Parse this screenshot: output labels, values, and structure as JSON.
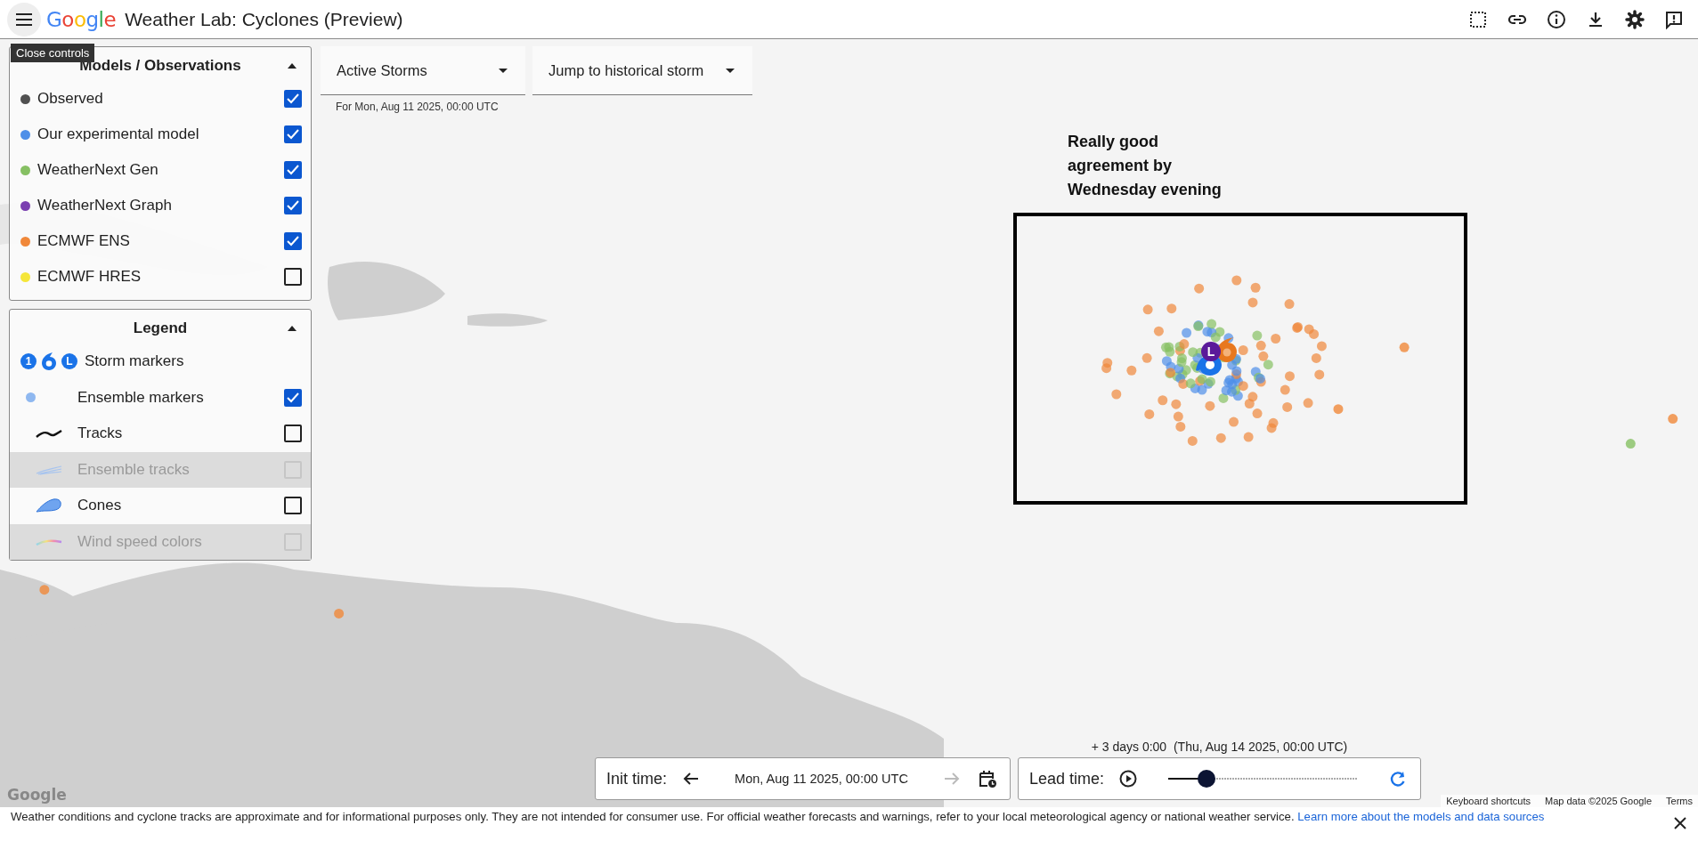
{
  "header": {
    "logo": "Google",
    "title": "Weather Lab: Cyclones (Preview)",
    "tooltip": "Close controls"
  },
  "models_panel": {
    "title": "Models / Observations",
    "expanded": true,
    "items": [
      {
        "label": "Observed",
        "color": "#505050",
        "checked": true
      },
      {
        "label": "Our experimental model",
        "color": "#4e8fe8",
        "checked": true
      },
      {
        "label": "WeatherNext Gen",
        "color": "#86c063",
        "checked": true
      },
      {
        "label": "WeatherNext Graph",
        "color": "#7a3fb0",
        "checked": true
      },
      {
        "label": "ECMWF ENS",
        "color": "#f0883a",
        "checked": true
      },
      {
        "label": "ECMWF HRES",
        "color": "#f5e63a",
        "checked": false
      }
    ]
  },
  "legend_panel": {
    "title": "Legend",
    "expanded": true,
    "items": [
      {
        "kind": "storm_markers",
        "label": "Storm markers",
        "glyphs": [
          "1",
          "L"
        ]
      },
      {
        "kind": "ensemble_markers",
        "label": "Ensemble markers",
        "checked": true,
        "disabled": false
      },
      {
        "kind": "tracks",
        "label": "Tracks",
        "checked": false,
        "disabled": false
      },
      {
        "kind": "ensemble_tracks",
        "label": "Ensemble tracks",
        "checked": false,
        "disabled": true
      },
      {
        "kind": "cones",
        "label": "Cones",
        "checked": false,
        "disabled": false
      },
      {
        "kind": "wind_speed",
        "label": "Wind speed colors",
        "checked": false,
        "disabled": true
      }
    ]
  },
  "dropdowns": [
    {
      "label": "Active Storms"
    },
    {
      "label": "Jump to historical storm"
    }
  ],
  "active_storms_caption": "For Mon, Aug 11 2025, 00:00 UTC",
  "map": {
    "annotation": "Really good agreement by Wednesday evening",
    "low_marker": "L",
    "logo": "Google",
    "footer": [
      "Keyboard shortcuts",
      "Map data ©2025 Google",
      "Terms"
    ]
  },
  "init_time": {
    "label": "Init time:",
    "value": "Mon, Aug 11 2025, 00:00 UTC",
    "prev_disabled": false,
    "next_disabled": true
  },
  "lead_time": {
    "label": "Lead time:",
    "reading": "+ 3 days 0:00  (Thu, Aug 14 2025, 00:00 UTC)",
    "level": 0.2
  },
  "disclaimer": {
    "text": "Weather conditions and cyclone tracks are approximate and for informational purposes only. They are not intended for consumer use. For official weather forecasts and warnings, refer to your local meteorological agency or national weather service.",
    "link": "Learn more about the models and data sources"
  }
}
